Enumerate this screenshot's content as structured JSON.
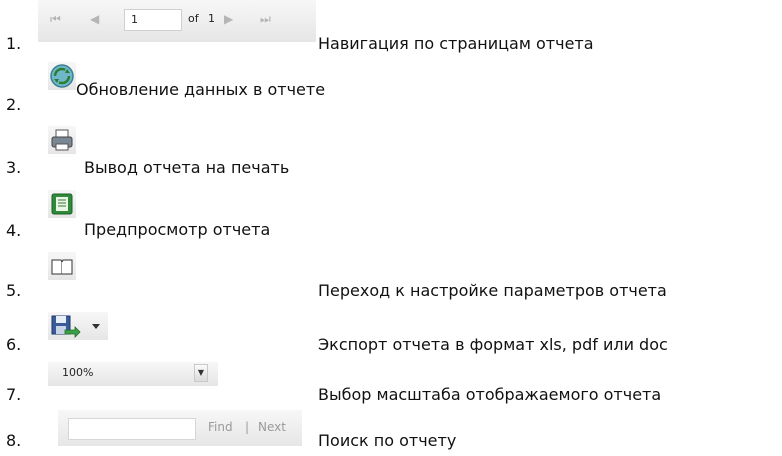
{
  "items": [
    {
      "number": "1.",
      "label": "Навигация по страницам отчета"
    },
    {
      "number": "2.",
      "label": "Обновление данных в отчете"
    },
    {
      "number": "3.",
      "label": "Вывод отчета на печать"
    },
    {
      "number": "4.",
      "label": "Предпросмотр отчета"
    },
    {
      "number": "5.",
      "label": "Переход к настройке параметров отчета"
    },
    {
      "number": "6.",
      "label": "Экспорт отчета в формат xls, pdf или doc"
    },
    {
      "number": "7.",
      "label": "Выбор масштаба отображаемого отчета"
    },
    {
      "number": "8.",
      "label": "Поиск по отчету"
    }
  ],
  "pager": {
    "first": "⏮",
    "prev": "◀",
    "page_value": "1",
    "of_label": "of",
    "total": "1",
    "next": "▶",
    "last": "⏭"
  },
  "zoom": {
    "value": "100%",
    "arrow": "▼"
  },
  "find": {
    "find_label": "Find",
    "separator": "|",
    "next_label": "Next"
  },
  "icons": {
    "refresh": "refresh-icon",
    "print": "print-icon",
    "preview": "preview-icon",
    "parameters": "parameters-book-icon",
    "export": "export-save-icon"
  }
}
